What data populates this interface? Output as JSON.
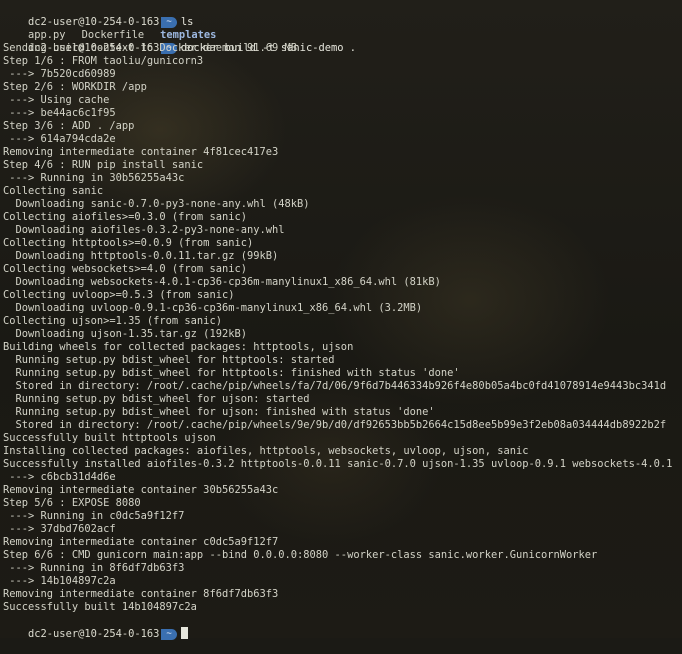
{
  "prompt": {
    "host": "dc2-user@10-254-0-163",
    "dir_symbol": "~"
  },
  "commands": {
    "ls": "ls",
    "build": "docker build -t sanic-demo ."
  },
  "ls_output": {
    "files": [
      "app.py",
      "Dockerfile"
    ],
    "dirs": [
      "templates"
    ]
  },
  "output_lines": [
    "Sending build context to Docker daemon 91.69 MB",
    "Step 1/6 : FROM taoliu/gunicorn3",
    " ---> 7b520cd60989",
    "Step 2/6 : WORKDIR /app",
    " ---> Using cache",
    " ---> be44ac6c1f95",
    "Step 3/6 : ADD . /app",
    " ---> 614a794cda2e",
    "Removing intermediate container 4f81cec417e3",
    "Step 4/6 : RUN pip install sanic",
    " ---> Running in 30b56255a43c",
    "Collecting sanic",
    "  Downloading sanic-0.7.0-py3-none-any.whl (48kB)",
    "Collecting aiofiles>=0.3.0 (from sanic)",
    "  Downloading aiofiles-0.3.2-py3-none-any.whl",
    "Collecting httptools>=0.0.9 (from sanic)",
    "  Downloading httptools-0.0.11.tar.gz (99kB)",
    "Collecting websockets>=4.0 (from sanic)",
    "  Downloading websockets-4.0.1-cp36-cp36m-manylinux1_x86_64.whl (81kB)",
    "Collecting uvloop>=0.5.3 (from sanic)",
    "  Downloading uvloop-0.9.1-cp36-cp36m-manylinux1_x86_64.whl (3.2MB)",
    "Collecting ujson>=1.35 (from sanic)",
    "  Downloading ujson-1.35.tar.gz (192kB)",
    "Building wheels for collected packages: httptools, ujson",
    "  Running setup.py bdist_wheel for httptools: started",
    "  Running setup.py bdist_wheel for httptools: finished with status 'done'",
    "  Stored in directory: /root/.cache/pip/wheels/fa/7d/06/9f6d7b446334b926f4e80b05a4bc0fd41078914e9443bc341d",
    "  Running setup.py bdist_wheel for ujson: started",
    "  Running setup.py bdist_wheel for ujson: finished with status 'done'",
    "  Stored in directory: /root/.cache/pip/wheels/9e/9b/d0/df92653bb5b2664c15d8ee5b99e3f2eb08a034444db8922b2f",
    "Successfully built httptools ujson",
    "Installing collected packages: aiofiles, httptools, websockets, uvloop, ujson, sanic",
    "Successfully installed aiofiles-0.3.2 httptools-0.0.11 sanic-0.7.0 ujson-1.35 uvloop-0.9.1 websockets-4.0.1",
    " ---> c6bcb31d4d6e",
    "Removing intermediate container 30b56255a43c",
    "Step 5/6 : EXPOSE 8080",
    " ---> Running in c0dc5a9f12f7",
    " ---> 37dbd7602acf",
    "Removing intermediate container c0dc5a9f12f7",
    "Step 6/6 : CMD gunicorn main:app --bind 0.0.0.0:8080 --worker-class sanic.worker.GunicornWorker",
    " ---> Running in 8f6df7db63f3",
    " ---> 14b104897c2a",
    "Removing intermediate container 8f6df7db63f3",
    "Successfully built 14b104897c2a"
  ]
}
